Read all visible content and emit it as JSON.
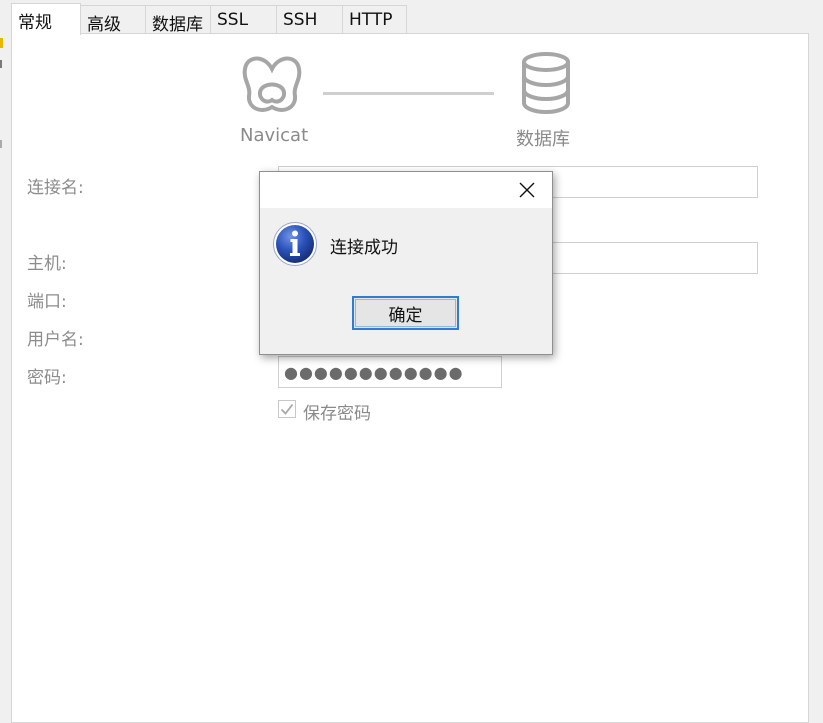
{
  "tabs": [
    {
      "label": "常规",
      "active": true
    },
    {
      "label": "高级",
      "active": false
    },
    {
      "label": "数据库",
      "active": false
    },
    {
      "label": "SSL",
      "active": false
    },
    {
      "label": "SSH",
      "active": false
    },
    {
      "label": "HTTP",
      "active": false
    }
  ],
  "header": {
    "left_caption": "Navicat",
    "right_caption": "数据库",
    "left_icon": "navicat-logo-icon",
    "right_icon": "database-icon"
  },
  "form": {
    "connection_name_label": "连接名:",
    "host_label": "主机:",
    "port_label": "端口:",
    "username_label": "用户名:",
    "password_label": "密码:",
    "password_value": "●●●●●●●●●●●●",
    "save_password_label": "保存密码",
    "save_password_checked": true
  },
  "dialog": {
    "message": "连接成功",
    "ok_label": "确定",
    "icon": "info-icon",
    "close_icon": "close-icon"
  },
  "colors": {
    "accent": "#2f7dd3",
    "info_icon": "#2449a8",
    "label_gray": "#8c8c8c",
    "icon_gray": "#a6a6a6"
  }
}
